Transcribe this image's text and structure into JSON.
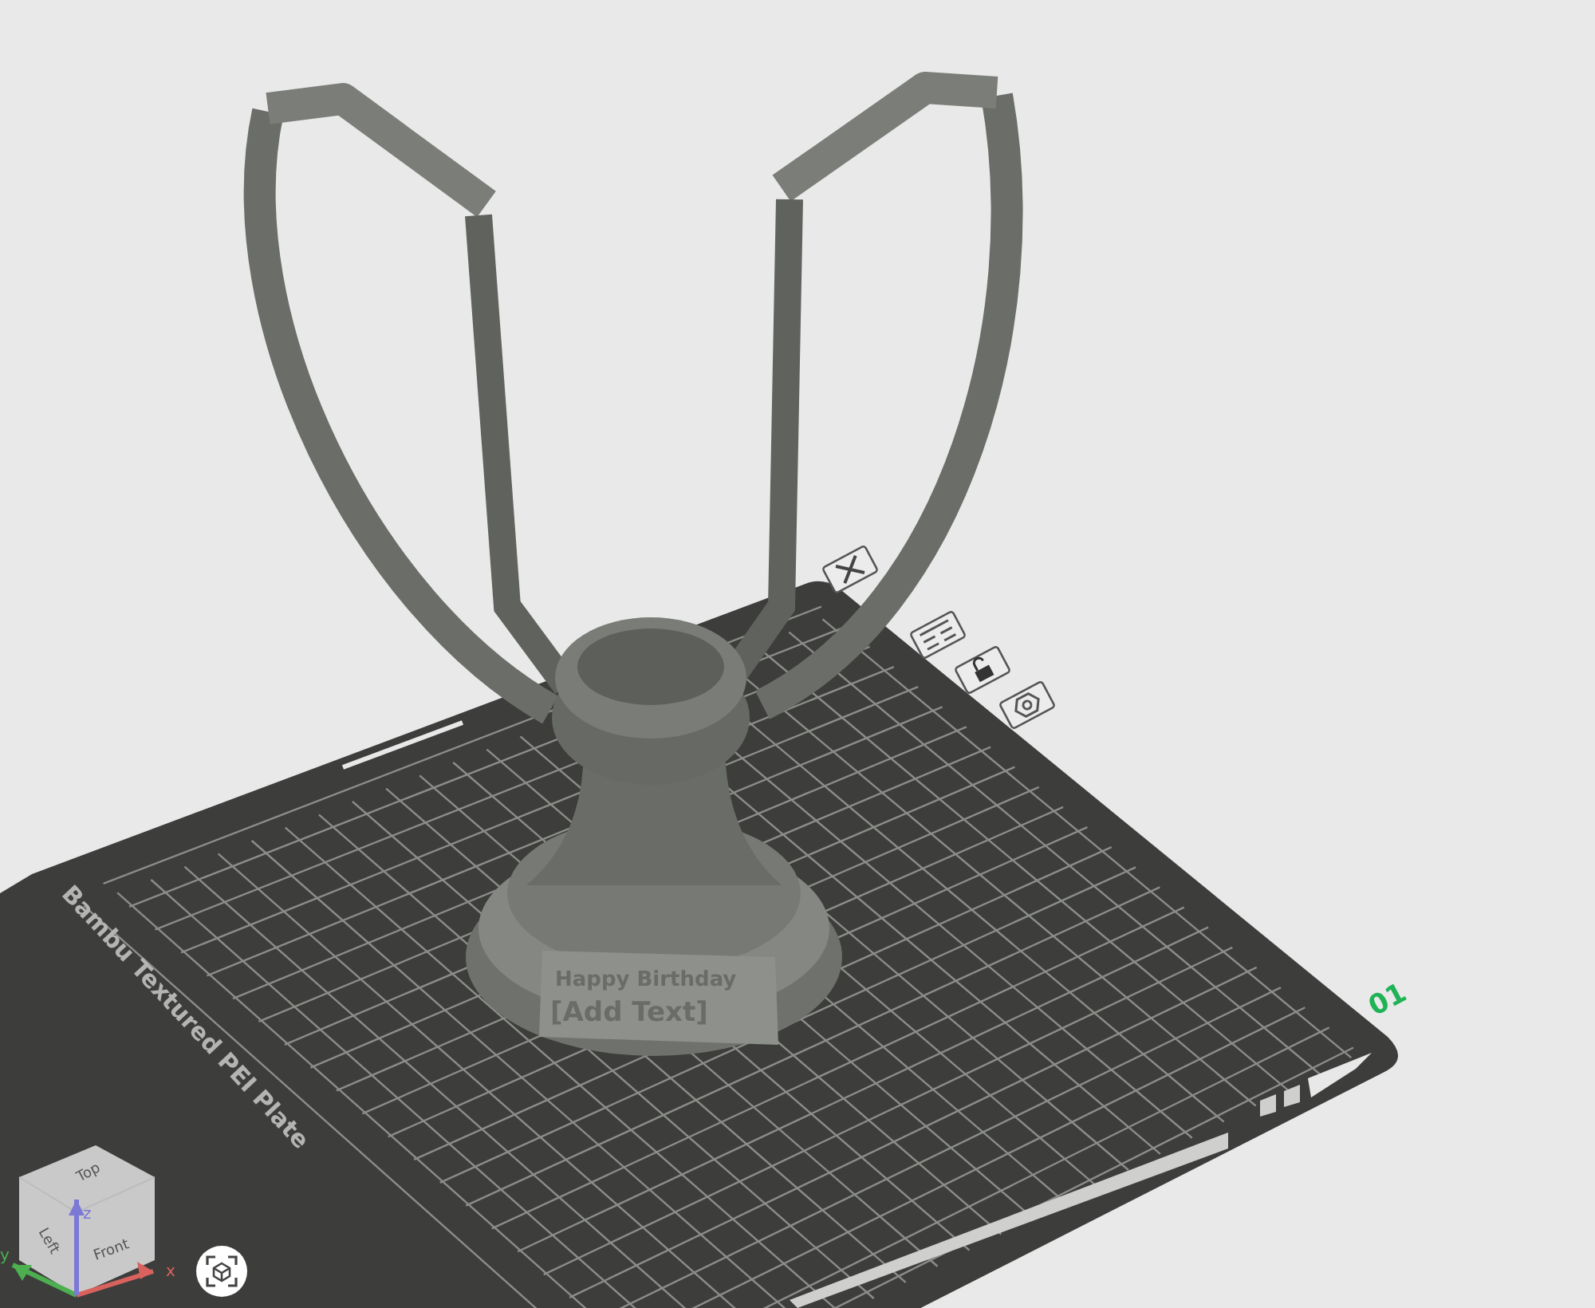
{
  "viewport": {
    "plate": {
      "name": "Bambu Textured PEI Plate",
      "number": "01",
      "tools": [
        {
          "kind": "close"
        },
        {
          "kind": "arrange"
        },
        {
          "kind": "lock"
        },
        {
          "kind": "settings"
        }
      ]
    },
    "model": {
      "nameplate": [
        "Happy Birthday",
        "[Add Text]"
      ]
    },
    "view_cube": {
      "faces": [
        "Top",
        "Left",
        "Front"
      ],
      "axes": [
        {
          "label": "x",
          "color": "#d9625e"
        },
        {
          "label": "y",
          "color": "#4caf50"
        },
        {
          "label": "z",
          "color": "#7b78d6"
        }
      ]
    },
    "buttons": [
      {
        "kind": "fit-view"
      }
    ]
  }
}
